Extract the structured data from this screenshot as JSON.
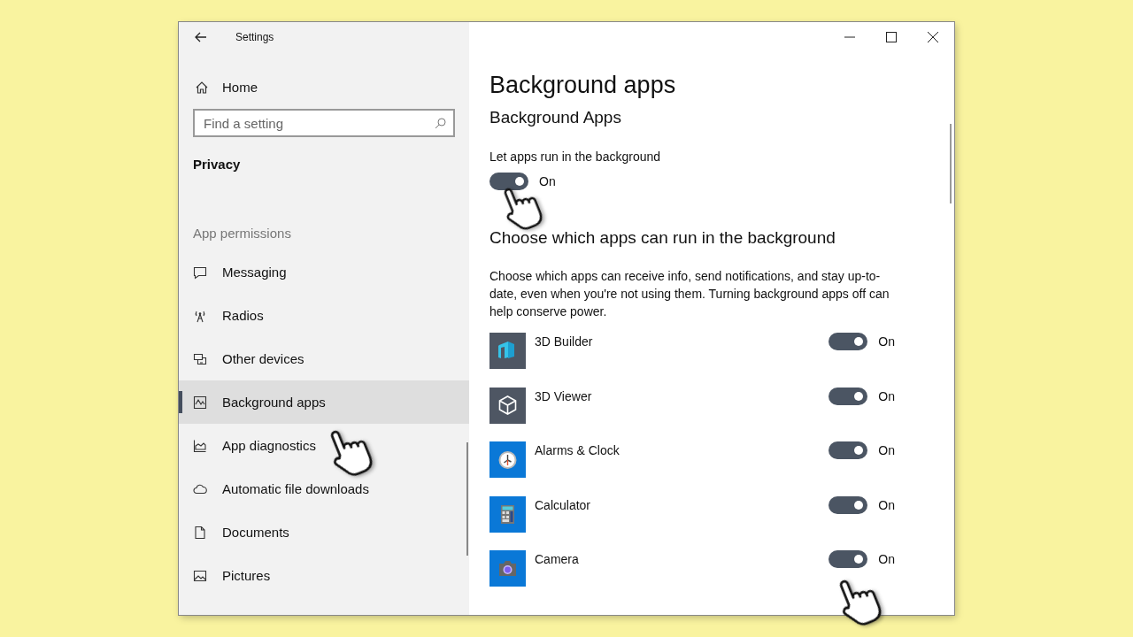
{
  "window": {
    "title": "Settings"
  },
  "sidebar": {
    "home": "Home",
    "search": {
      "placeholder": "Find a setting"
    },
    "section": "Privacy",
    "group": "App permissions",
    "items": [
      {
        "label": "Messaging",
        "selected": false
      },
      {
        "label": "Radios",
        "selected": false
      },
      {
        "label": "Other devices",
        "selected": false
      },
      {
        "label": "Background apps",
        "selected": true
      },
      {
        "label": "App diagnostics",
        "selected": false
      },
      {
        "label": "Automatic file downloads",
        "selected": false
      },
      {
        "label": "Documents",
        "selected": false
      },
      {
        "label": "Pictures",
        "selected": false
      }
    ]
  },
  "content": {
    "title": "Background apps",
    "subtitle": "Background Apps",
    "master": {
      "label": "Let apps run in the background",
      "on": true,
      "state": "On"
    },
    "heading": "Choose which apps can run in the background",
    "description": "Choose which apps can receive info, send notifications, and stay up-to-date, even when you're not using them. Turning background apps off can help conserve power.",
    "apps": [
      {
        "name": "3D Builder",
        "on": true,
        "state": "On"
      },
      {
        "name": "3D Viewer",
        "on": true,
        "state": "On"
      },
      {
        "name": "Alarms & Clock",
        "on": true,
        "state": "On"
      },
      {
        "name": "Calculator",
        "on": true,
        "state": "On"
      },
      {
        "name": "Camera",
        "on": true,
        "state": "On"
      }
    ]
  }
}
